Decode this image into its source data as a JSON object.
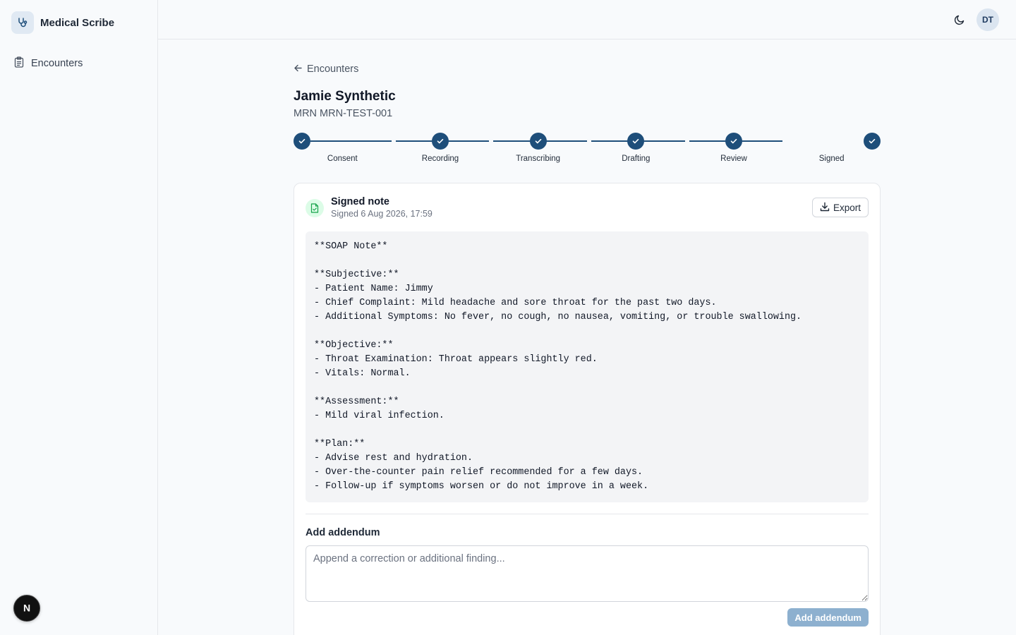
{
  "app": {
    "name": "Medical Scribe",
    "logo_icon": "stethoscope-icon"
  },
  "sidebar": {
    "items": [
      {
        "label": "Encounters",
        "icon": "clipboard-icon"
      }
    ],
    "footer_badge": "N"
  },
  "topbar": {
    "theme_icon": "moon-icon",
    "avatar_initials": "DT"
  },
  "breadcrumb": {
    "back_label": "Encounters"
  },
  "patient": {
    "name": "Jamie Synthetic",
    "mrn": "MRN MRN-TEST-001"
  },
  "stepper": {
    "steps": [
      {
        "label": "Consent",
        "status": "complete"
      },
      {
        "label": "Recording",
        "status": "complete"
      },
      {
        "label": "Transcribing",
        "status": "complete"
      },
      {
        "label": "Drafting",
        "status": "complete"
      },
      {
        "label": "Review",
        "status": "complete"
      },
      {
        "label": "Signed",
        "status": "complete"
      }
    ],
    "color": "#1e4e7a"
  },
  "note_card": {
    "title": "Signed note",
    "signed_at": "Signed 6 Aug 2026, 17:59",
    "export_label": "Export",
    "body": "**SOAP Note**\n\n**Subjective:**\n- Patient Name: Jimmy\n- Chief Complaint: Mild headache and sore throat for the past two days.\n- Additional Symptoms: No fever, no cough, no nausea, vomiting, or trouble swallowing.\n\n**Objective:**\n- Throat Examination: Throat appears slightly red.\n- Vitals: Normal.\n\n**Assessment:**\n- Mild viral infection.\n\n**Plan:**\n- Advise rest and hydration.\n- Over-the-counter pain relief recommended for a few days.\n- Follow-up if symptoms worsen or do not improve in a week."
  },
  "addendum": {
    "label": "Add addendum",
    "placeholder": "Append a correction or additional finding...",
    "value": "",
    "button_label": "Add addendum",
    "button_disabled": true
  }
}
